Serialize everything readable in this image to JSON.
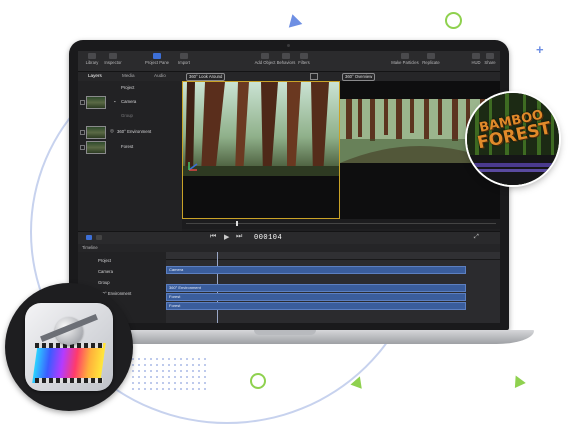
{
  "toolbar": {
    "library_label": "Library",
    "inspector_label": "Inspector",
    "project_pane_label": "Project Pane",
    "import_label": "Import",
    "add_object_label": "Add Object",
    "behaviors_label": "Behaviors",
    "filters_label": "Filters",
    "make_particles_label": "Make Particles",
    "replicate_label": "Replicate",
    "hud_label": "HUD",
    "share_label": "Share"
  },
  "browser": {
    "tabs": [
      {
        "label": "Layers"
      },
      {
        "label": "Media"
      },
      {
        "label": "Audio"
      }
    ],
    "project_label": "Project",
    "layers": [
      {
        "label": "Camera"
      },
      {
        "label": "Group"
      },
      {
        "label": "360° Environment"
      },
      {
        "label": "Forest"
      }
    ]
  },
  "viewers": {
    "left_dropdown": "360° Look Around",
    "right_dropdown": "360° Overview",
    "fit_label": "Fit: 34%",
    "render_label": "Render",
    "view_label": "View"
  },
  "transport": {
    "timecode": "000104"
  },
  "timeline": {
    "title": "Timeline",
    "index_rows": [
      {
        "label": "Project"
      },
      {
        "label": "Camera"
      },
      {
        "label": "Group"
      },
      {
        "label": "360° Environment"
      },
      {
        "label": "Forest"
      }
    ],
    "clips": [
      {
        "label": "Camera"
      },
      {
        "label": "360° Environment"
      },
      {
        "label": "Forest"
      },
      {
        "label": "Forest"
      }
    ]
  },
  "badge": {
    "title_line1": "BAMBOO",
    "title_line2": "FOREST"
  },
  "colors": {
    "accent_blue": "#3d6fd6",
    "selection_gold": "#c9a227",
    "clip_blue": "#3a5d9c",
    "deco_green": "#8fd14f",
    "deco_blue": "#6e8fe3"
  }
}
